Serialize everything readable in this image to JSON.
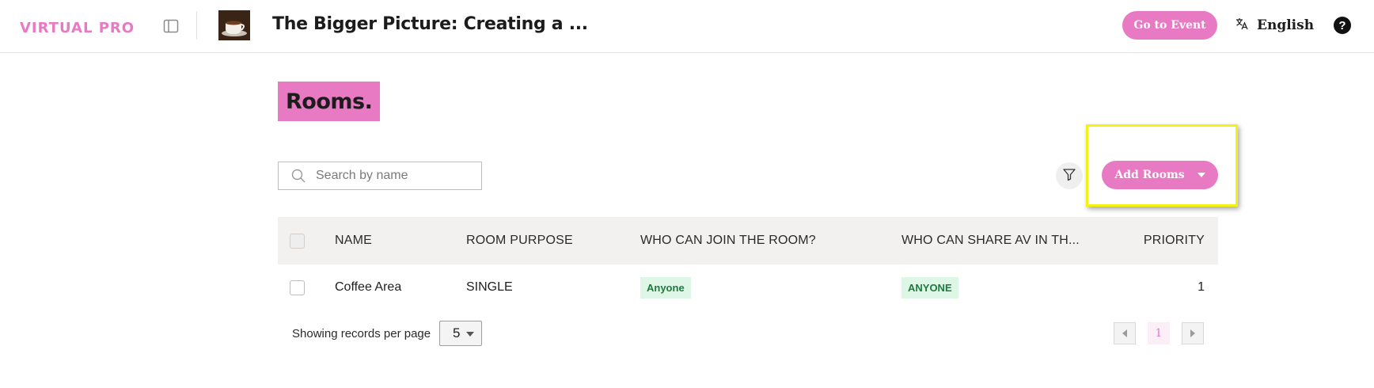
{
  "header": {
    "logo_text": "VIRTUAL PRO",
    "event_title": "The Bigger Picture: Creating a ...",
    "go_to_event_label": "Go to Event",
    "language_label": "English",
    "help_symbol": "?"
  },
  "page": {
    "title": "Rooms."
  },
  "toolbar": {
    "search_placeholder": "Search by name",
    "add_rooms_label": "Add Rooms"
  },
  "table": {
    "columns": [
      "NAME",
      "ROOM PURPOSE",
      "WHO CAN JOIN THE ROOM?",
      "WHO CAN SHARE AV IN TH...",
      "PRIORITY"
    ],
    "rows": [
      {
        "name": "Coffee Area",
        "purpose": "SINGLE",
        "who_can_join": "Anyone",
        "who_can_share": "ANYONE",
        "priority": "1"
      }
    ]
  },
  "footer": {
    "records_per_page_label": "Showing records per page",
    "records_per_page_value": "5",
    "current_page": "1"
  },
  "colors": {
    "brand_pink": "#e879c3",
    "badge_bg": "#ddf6e6",
    "badge_text": "#1f7a3e",
    "highlight": "#f2f215"
  }
}
